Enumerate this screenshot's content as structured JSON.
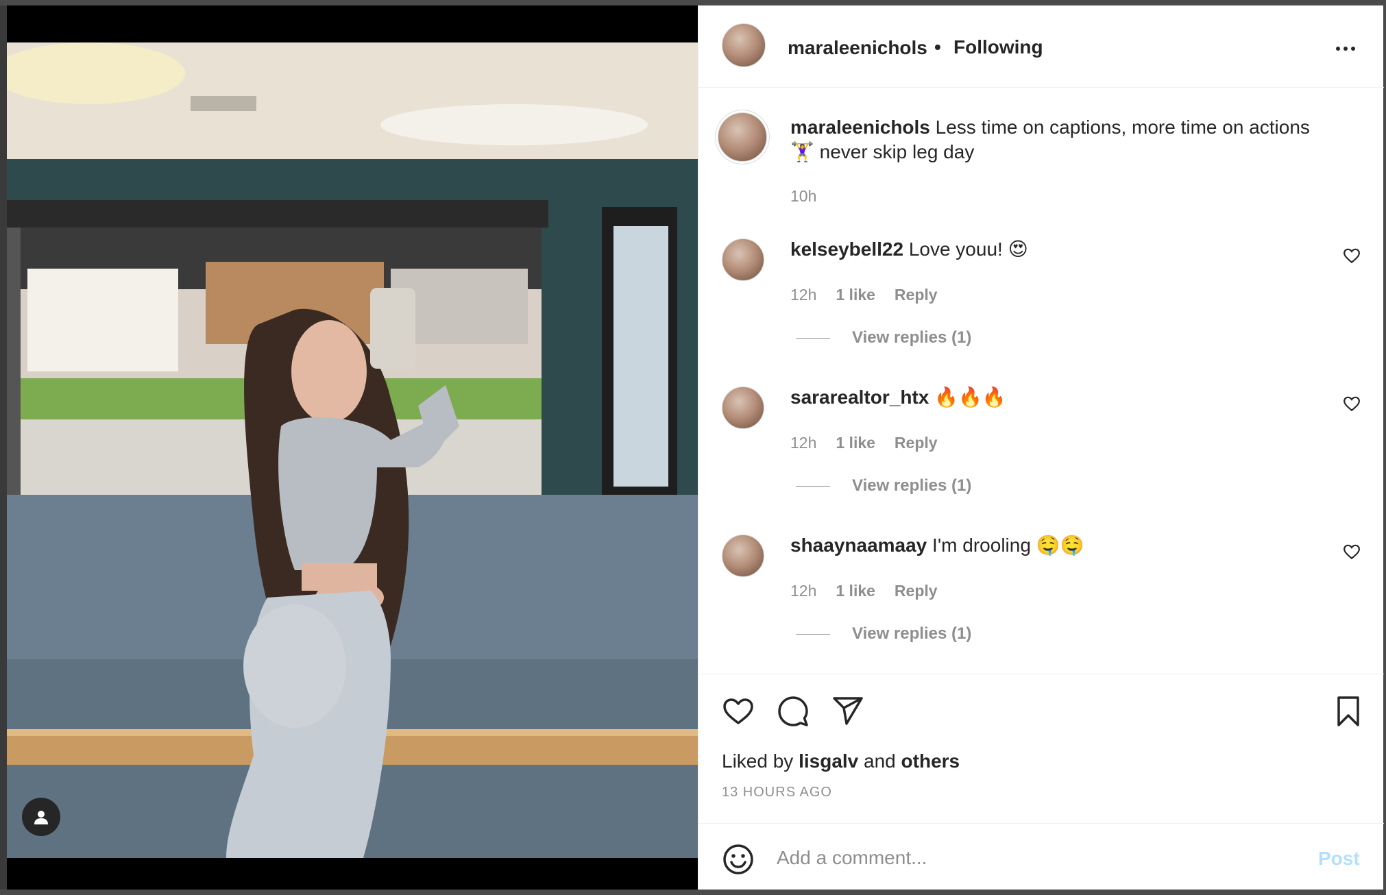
{
  "post": {
    "username": "maraleenichols",
    "separator": "•",
    "follow_status": "Following",
    "caption_user": "maraleenichols",
    "caption_text": "Less time on captions, more time on actions",
    "caption_line2": "🏋️‍♀️ never skip leg day",
    "caption_time": "10h"
  },
  "comments": [
    {
      "user": "kelseybell22",
      "text": "Love youu! 😍",
      "time": "12h",
      "likes": "1 like",
      "reply": "Reply",
      "view_replies": "View replies (1)"
    },
    {
      "user": "sararealtor_htx",
      "text": "🔥🔥🔥",
      "time": "12h",
      "likes": "1 like",
      "reply": "Reply",
      "view_replies": "View replies (1)"
    },
    {
      "user": "shaaynaamaay",
      "text": "I'm drooling 🤤🤤",
      "time": "12h",
      "likes": "1 like",
      "reply": "Reply",
      "view_replies": "View replies (1)"
    }
  ],
  "actions": {
    "liked_prefix": "Liked by",
    "liked_user": "lisgalv",
    "liked_mid": "and",
    "liked_others": "others",
    "timestamp": "13 HOURS AGO"
  },
  "add_comment": {
    "placeholder": "Add a comment...",
    "post_label": "Post"
  },
  "icons": {
    "more": "more-options-icon",
    "like": "heart-icon",
    "comment": "comment-icon",
    "share": "share-icon",
    "save": "bookmark-icon",
    "emoji": "emoji-icon",
    "tagged_user": "user-tag-icon"
  },
  "colors": {
    "text": "#262626",
    "secondary": "#8e8e8e",
    "post_disabled": "#b2dffc",
    "border": "#efefef"
  }
}
